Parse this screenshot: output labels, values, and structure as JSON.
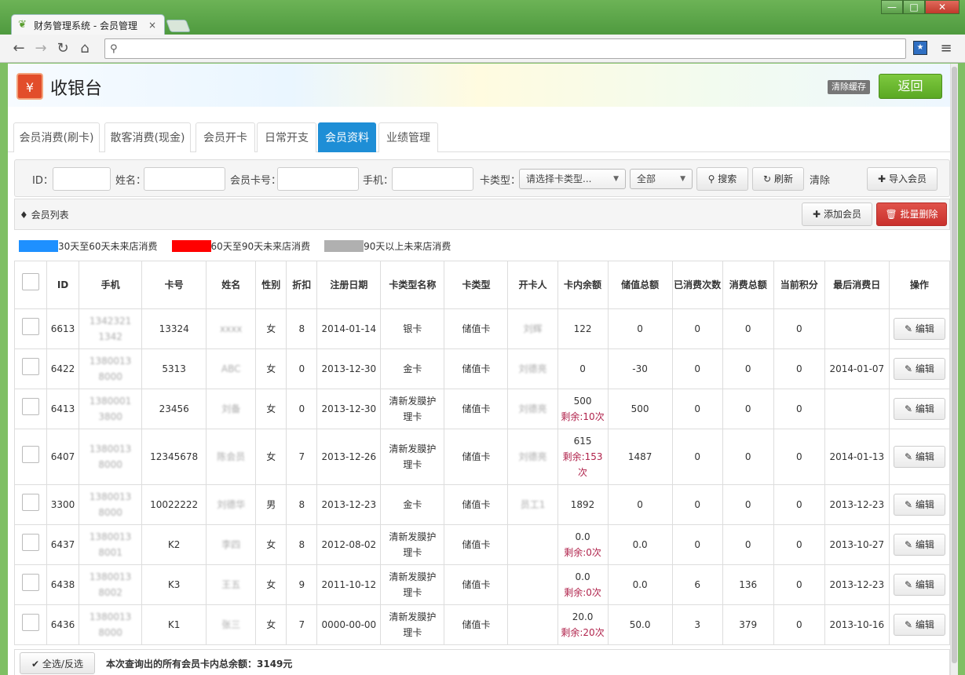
{
  "browser": {
    "tab_title": "财务管理系统 - 会员管理",
    "tab_close": "×",
    "window_controls": [
      "—",
      "□",
      "✕"
    ],
    "back": "←",
    "forward": "→",
    "reload": "↻",
    "home": "⌂",
    "menu": "≡",
    "address_value": ""
  },
  "app": {
    "title": "收银台",
    "clear_cache_label": "清除缓存",
    "back_label": "返回",
    "logo_icon": "register-icon"
  },
  "nav_tabs": [
    {
      "label": "会员消费(刷卡)",
      "active": false
    },
    {
      "label": "散客消费(现金)",
      "active": false
    },
    {
      "label": "会员开卡",
      "active": false
    },
    {
      "label": "日常开支",
      "active": false
    },
    {
      "label": "会员资料",
      "active": true
    },
    {
      "label": "业绩管理",
      "active": false
    }
  ],
  "filter": {
    "id_label": "ID：",
    "name_label": "姓名：",
    "card_label": "会员卡号：",
    "phone_label": "手机：",
    "card_type_label": "卡类型：",
    "card_type_placeholder": "请选择卡类型...",
    "status_select": "全部",
    "search_label": "搜索",
    "refresh_label": "刷新",
    "clear_label": "清除",
    "import_label": "导入会员"
  },
  "list": {
    "title": "会员列表",
    "add_label": "添加会员",
    "batch_delete_label": "批量删除"
  },
  "legend": [
    {
      "color": "#1e90ff",
      "label": "30天至60天未来店消费"
    },
    {
      "color": "#ff0000",
      "label": "60天至90天未来店消费"
    },
    {
      "color": "#b0b0b0",
      "label": "90天以上未来店消费"
    }
  ],
  "table": {
    "headers": [
      "",
      "ID",
      "手机",
      "卡号",
      "姓名",
      "性别",
      "折扣",
      "注册日期",
      "卡类型名称",
      "卡类型",
      "开卡人",
      "卡内余额",
      "储值总额",
      "已消费次数",
      "消费总额",
      "当前积分",
      "最后消费日",
      "操作"
    ],
    "edit_label": "编辑",
    "rows": [
      {
        "id": "6613",
        "phone": "13423211342",
        "card": "13324",
        "name": "xxxx",
        "gender": "女",
        "discount": "8",
        "reg_date": "2014-01-14",
        "card_type_name": "银卡",
        "card_type": "储值卡",
        "opener": "刘辉",
        "balance": "122",
        "remain": "",
        "stored_total": "0",
        "used_times": "0",
        "spent_total": "0",
        "points": "0",
        "last_date": ""
      },
      {
        "id": "6422",
        "phone": "13800138000",
        "card": "5313",
        "name": "ABC",
        "gender": "女",
        "discount": "0",
        "reg_date": "2013-12-30",
        "card_type_name": "金卡",
        "card_type": "储值卡",
        "opener": "刘德亮",
        "balance": "0",
        "remain": "",
        "stored_total": "-30",
        "used_times": "0",
        "spent_total": "0",
        "points": "0",
        "last_date": "2014-01-07"
      },
      {
        "id": "6413",
        "phone": "13800013800",
        "card": "23456",
        "name": "刘备",
        "gender": "女",
        "discount": "0",
        "reg_date": "2013-12-30",
        "card_type_name": "清新发膜护理卡",
        "card_type": "储值卡",
        "opener": "刘德亮",
        "balance": "500",
        "remain": "剩余:10次",
        "stored_total": "500",
        "used_times": "0",
        "spent_total": "0",
        "points": "0",
        "last_date": ""
      },
      {
        "id": "6407",
        "phone": "13800138000",
        "card": "12345678",
        "name": "陈会员",
        "gender": "女",
        "discount": "7",
        "reg_date": "2013-12-26",
        "card_type_name": "清新发膜护理卡",
        "card_type": "储值卡",
        "opener": "刘德亮",
        "balance": "615",
        "remain": "剩余:153次",
        "stored_total": "1487",
        "used_times": "0",
        "spent_total": "0",
        "points": "0",
        "last_date": "2014-01-13"
      },
      {
        "id": "3300",
        "phone": "13800138000",
        "card": "10022222",
        "name": "刘德华",
        "gender": "男",
        "discount": "8",
        "reg_date": "2013-12-23",
        "card_type_name": "金卡",
        "card_type": "储值卡",
        "opener": "员工1",
        "balance": "1892",
        "remain": "",
        "stored_total": "0",
        "used_times": "0",
        "spent_total": "0",
        "points": "0",
        "last_date": "2013-12-23"
      },
      {
        "id": "6437",
        "phone": "13800138001",
        "card": "K2",
        "name": "李四",
        "gender": "女",
        "discount": "8",
        "reg_date": "2012-08-02",
        "card_type_name": "清新发膜护理卡",
        "card_type": "储值卡",
        "opener": "",
        "balance": "0.0",
        "remain": "剩余:0次",
        "stored_total": "0.0",
        "used_times": "0",
        "spent_total": "0",
        "points": "0",
        "last_date": "2013-10-27"
      },
      {
        "id": "6438",
        "phone": "13800138002",
        "card": "K3",
        "name": "王五",
        "gender": "女",
        "discount": "9",
        "reg_date": "2011-10-12",
        "card_type_name": "清新发膜护理卡",
        "card_type": "储值卡",
        "opener": "",
        "balance": "0.0",
        "remain": "剩余:0次",
        "stored_total": "0.0",
        "used_times": "6",
        "spent_total": "136",
        "points": "0",
        "last_date": "2013-12-23"
      },
      {
        "id": "6436",
        "phone": "13800138000",
        "card": "K1",
        "name": "张三",
        "gender": "女",
        "discount": "7",
        "reg_date": "0000-00-00",
        "card_type_name": "清新发膜护理卡",
        "card_type": "储值卡",
        "opener": "",
        "balance": "20.0",
        "remain": "剩余:20次",
        "stored_total": "50.0",
        "used_times": "3",
        "spent_total": "379",
        "points": "0",
        "last_date": "2013-10-16"
      }
    ]
  },
  "footer": {
    "select_label": "全选/反选",
    "summary": "本次查询出的所有会员卡内总余额：3149元"
  }
}
